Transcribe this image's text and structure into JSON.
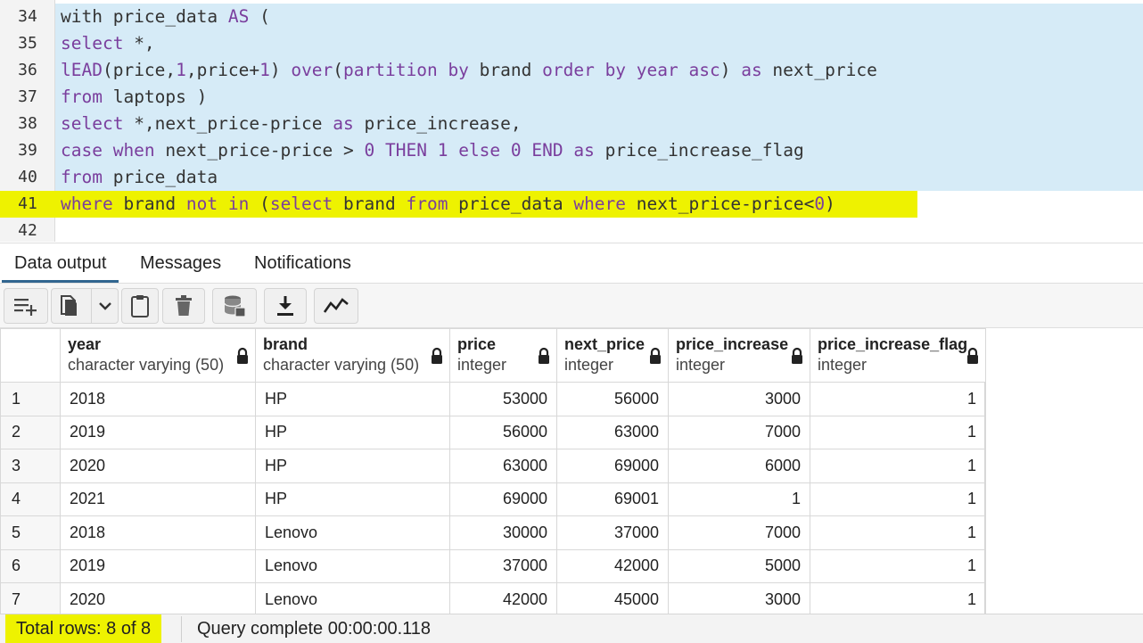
{
  "editor": {
    "lines": [
      {
        "n": "34",
        "parts": [
          [
            "tok",
            "with price_data "
          ],
          [
            "kw",
            "AS"
          ],
          [
            "tok",
            " ("
          ]
        ]
      },
      {
        "n": "35",
        "parts": [
          [
            "kw",
            "select"
          ],
          [
            "tok",
            " *,"
          ]
        ]
      },
      {
        "n": "36",
        "parts": [
          [
            "kw",
            "lEAD"
          ],
          [
            "tok",
            "(price,"
          ],
          [
            "num",
            "1"
          ],
          [
            "tok",
            ",price+"
          ],
          [
            "num",
            "1"
          ],
          [
            "tok",
            ") "
          ],
          [
            "kw",
            "over"
          ],
          [
            "tok",
            "("
          ],
          [
            "kw",
            "partition by"
          ],
          [
            "tok",
            " brand "
          ],
          [
            "kw",
            "order by year asc"
          ],
          [
            "tok",
            ") "
          ],
          [
            "kw",
            "as"
          ],
          [
            "tok",
            " next_price"
          ]
        ]
      },
      {
        "n": "37",
        "parts": [
          [
            "kw",
            "from"
          ],
          [
            "tok",
            " laptops )"
          ]
        ]
      },
      {
        "n": "38",
        "parts": [
          [
            "kw",
            "select"
          ],
          [
            "tok",
            " *,next_price-price "
          ],
          [
            "kw",
            "as"
          ],
          [
            "tok",
            " price_increase,"
          ]
        ]
      },
      {
        "n": "39",
        "parts": [
          [
            "kw",
            "case when"
          ],
          [
            "tok",
            " next_price-price > "
          ],
          [
            "num",
            "0"
          ],
          [
            "tok",
            " "
          ],
          [
            "kw",
            "THEN"
          ],
          [
            "tok",
            " "
          ],
          [
            "num",
            "1"
          ],
          [
            "tok",
            " "
          ],
          [
            "kw",
            "else"
          ],
          [
            "tok",
            " "
          ],
          [
            "num",
            "0"
          ],
          [
            "tok",
            " "
          ],
          [
            "kw",
            "END"
          ],
          [
            "tok",
            " "
          ],
          [
            "kw",
            "as"
          ],
          [
            "tok",
            " price_increase_flag"
          ]
        ]
      },
      {
        "n": "40",
        "parts": [
          [
            "kw",
            "from"
          ],
          [
            "tok",
            " price_data"
          ]
        ]
      },
      {
        "n": "41",
        "parts": [
          [
            "kw",
            "where"
          ],
          [
            "tok",
            " brand "
          ],
          [
            "kw",
            "not in"
          ],
          [
            "tok",
            " ("
          ],
          [
            "kw",
            "select"
          ],
          [
            "tok",
            " brand "
          ],
          [
            "kw",
            "from"
          ],
          [
            "tok",
            " price_data "
          ],
          [
            "kw",
            "where"
          ],
          [
            "tok",
            " next_price-price<"
          ],
          [
            "num",
            "0"
          ],
          [
            "tok",
            ")"
          ]
        ]
      },
      {
        "n": "42",
        "parts": []
      }
    ]
  },
  "tabs": [
    {
      "label": "Data output",
      "active": true
    },
    {
      "label": "Messages",
      "active": false
    },
    {
      "label": "Notifications",
      "active": false
    }
  ],
  "toolbar": {
    "icons": [
      "add-row-icon",
      "copy-icon",
      "chevron-down-icon",
      "paste-icon",
      "delete-icon",
      "save-data-icon",
      "download-icon",
      "graph-icon"
    ]
  },
  "grid": {
    "columns": [
      {
        "name": "year",
        "type": "character varying (50)"
      },
      {
        "name": "brand",
        "type": "character varying (50)"
      },
      {
        "name": "price",
        "type": "integer"
      },
      {
        "name": "next_price",
        "type": "integer"
      },
      {
        "name": "price_increase",
        "type": "integer"
      },
      {
        "name": "price_increase_flag",
        "type": "integer"
      }
    ],
    "rows": [
      [
        "1",
        "2018",
        "HP",
        "53000",
        "56000",
        "3000",
        "1"
      ],
      [
        "2",
        "2019",
        "HP",
        "56000",
        "63000",
        "7000",
        "1"
      ],
      [
        "3",
        "2020",
        "HP",
        "63000",
        "69000",
        "6000",
        "1"
      ],
      [
        "4",
        "2021",
        "HP",
        "69000",
        "69001",
        "1",
        "1"
      ],
      [
        "5",
        "2018",
        "Lenovo",
        "30000",
        "37000",
        "7000",
        "1"
      ],
      [
        "6",
        "2019",
        "Lenovo",
        "37000",
        "42000",
        "5000",
        "1"
      ],
      [
        "7",
        "2020",
        "Lenovo",
        "42000",
        "45000",
        "3000",
        "1"
      ]
    ]
  },
  "status": {
    "total_rows": "Total rows: 8 of 8",
    "query": "Query complete 00:00:00.118"
  },
  "colors": {
    "selection": "#d6ebf7",
    "highlight": "#eef200",
    "keyword": "#7a3e9d"
  }
}
